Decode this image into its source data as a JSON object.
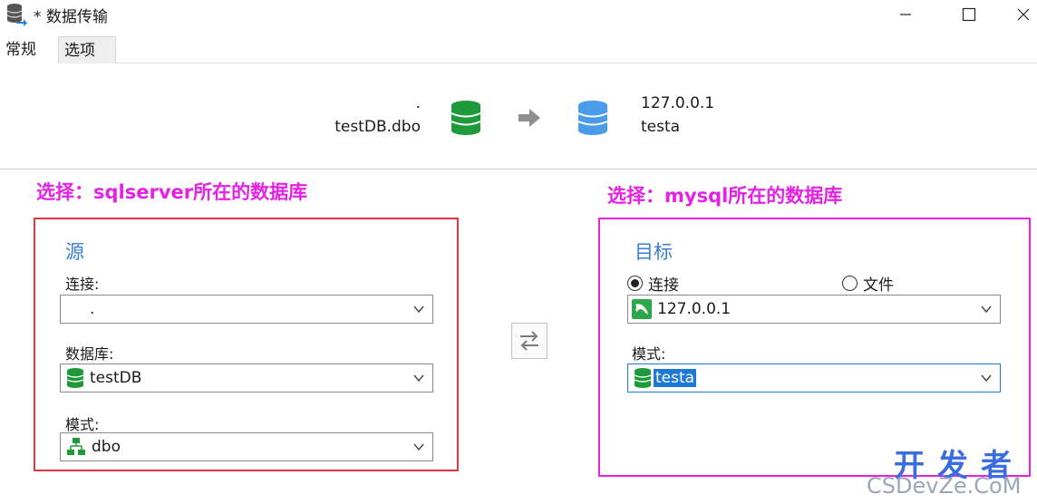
{
  "window": {
    "title": "* 数据传输",
    "controls": {
      "minimize": "minimize",
      "maximize": "maximize",
      "close": "close"
    }
  },
  "tabs": [
    {
      "label": "常规",
      "active": true
    },
    {
      "label": "选项",
      "active": false
    }
  ],
  "summary": {
    "source_host": ".",
    "source_name": "testDB.dbo",
    "target_host": "127.0.0.1",
    "target_name": "testa"
  },
  "annotations": {
    "left": "选择：sqlserver所在的数据库",
    "right": "选择：mysql所在的数据库"
  },
  "source": {
    "title": "源",
    "connection_label": "连接:",
    "connection_value": ".",
    "database_label": "数据库:",
    "database_value": "testDB",
    "schema_label": "模式:",
    "schema_value": "dbo"
  },
  "target": {
    "title": "目标",
    "radio_connection": "连接",
    "radio_file": "文件",
    "selected_radio": "connection",
    "connection_value": "127.0.0.1",
    "schema_label": "模式:",
    "schema_value": "testa"
  },
  "watermark": {
    "cn": "开发者",
    "en": "CSDevZe.CoM"
  },
  "colors": {
    "accent_blue": "#3a7fcf",
    "annotation_magenta": "#e621e6",
    "box_red": "#e8343e",
    "db_green": "#1f9a3a",
    "db_blue": "#4a9be8",
    "selection": "#1e78d7"
  },
  "icons": {
    "app": "database-transfer-icon",
    "source_db": "green-database-icon",
    "arrow": "right-arrow-icon",
    "target_db": "blue-database-icon",
    "swap": "swap-arrows-icon",
    "mysql": "mysql-dolphin-icon",
    "schema": "schema-tree-icon",
    "chevron": "chevron-down-icon"
  }
}
